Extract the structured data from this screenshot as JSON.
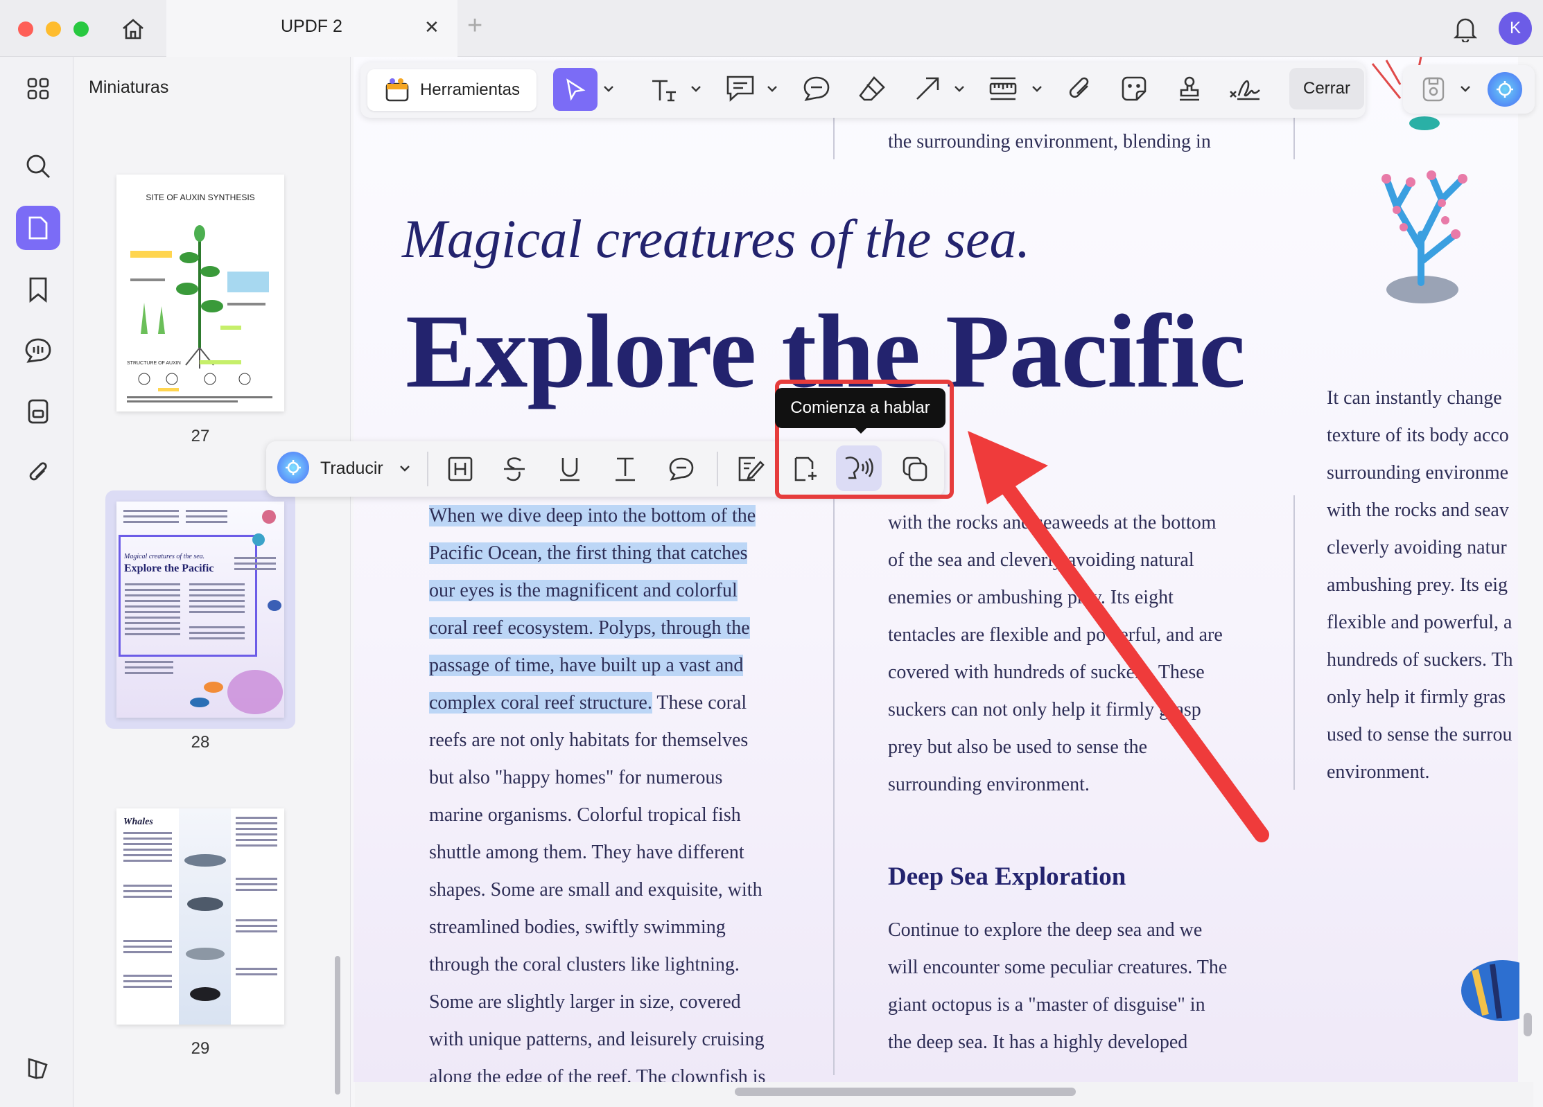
{
  "titlebar": {
    "tab_title": "UPDF 2",
    "close_tab": "✕",
    "new_tab": "+",
    "avatar_letter": "K"
  },
  "sidebar": {
    "panel_title": "Miniaturas",
    "thumbnails": [
      {
        "page": "27",
        "title": "SITE OF AUXIN SYNTHESIS",
        "subtitle": "STRUCTURE OF AUXIN"
      },
      {
        "page": "28",
        "heading_italic": "Magical creatures of the sea.",
        "heading": "Explore the Pacific"
      },
      {
        "page": "29",
        "heading": "Whales"
      }
    ]
  },
  "toolbar": {
    "tools_label": "Herramientas",
    "close_label": "Cerrar"
  },
  "float_toolbar": {
    "translate_label": "Traducir",
    "tooltip": "Comienza a hablar"
  },
  "document": {
    "top_right_line": "the surrounding environment, blending in",
    "subtitle": "Magical creatures of the sea.",
    "title": "Explore the Pacific",
    "col1_highlighted": [
      "When we dive deep into the bottom of the",
      "Pacific Ocean, the first thing that catches",
      "our eyes is the magnificent and colorful",
      "coral reef ecosystem. Polyps, through the",
      "passage of time, have built up a vast and"
    ],
    "col1_line6_hl": "complex coral reef structure.",
    "col1_line6_rest": " These coral",
    "col1_rest": [
      "reefs are not only habitats for themselves",
      "but also \"happy homes\" for numerous",
      "marine organisms. Colorful tropical fish",
      "shuttle among them. They have different",
      "shapes. Some are small and exquisite, with",
      "streamlined bodies, swiftly swimming",
      "through the coral clusters like lightning.",
      "Some are slightly larger in size, covered",
      "with unique patterns, and leisurely cruising",
      "along the edge of the reef. The clownfish is"
    ],
    "col2_lines": [
      "with the rocks and seaweeds at the bottom",
      "of the sea and cleverly avoiding natural",
      "enemies or ambushing prey. Its eight",
      "tentacles are flexible and powerful, and are",
      "covered with hundreds of suckers. These",
      "suckers can not only help it firmly grasp",
      "prey but also be used to sense the",
      "surrounding environment."
    ],
    "col2_heading": "Deep Sea Exploration",
    "col2_para2": [
      "Continue to explore the deep sea and we",
      "will encounter some peculiar creatures. The",
      "giant octopus is a \"master of disguise\" in",
      "the deep sea. It has a highly developed"
    ],
    "col3_lines": [
      "It can instantly change",
      "texture of its body acco",
      "surrounding environme",
      "with the rocks and seav",
      "cleverly avoiding natur",
      "ambushing prey. Its eig",
      "flexible and powerful, a",
      "hundreds of suckers. Th",
      "only help it firmly gras",
      "used to sense the surrou",
      "environment."
    ]
  },
  "colors": {
    "accent": "#7b6cf6",
    "title_navy": "#23236e",
    "highlight": "#bcd6f6",
    "annotation_red": "#e63c3c"
  }
}
